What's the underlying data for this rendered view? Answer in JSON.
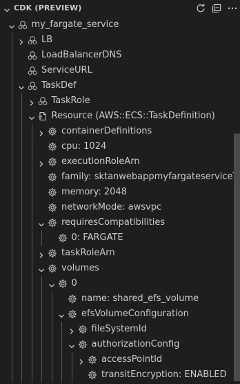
{
  "header": {
    "title": "CDK (PREVIEW)",
    "actions": [
      {
        "name": "refresh-icon"
      },
      {
        "name": "collapse-all-icon"
      }
    ]
  },
  "tree": [
    {
      "label": "my_fargate_service",
      "depth": 1,
      "twisty": "expanded",
      "icon": "construct-icon"
    },
    {
      "label": "LB",
      "depth": 2,
      "twisty": "collapsed",
      "icon": "construct-icon"
    },
    {
      "label": "LoadBalancerDNS",
      "depth": 2,
      "twisty": "none",
      "icon": "construct-icon"
    },
    {
      "label": "ServiceURL",
      "depth": 2,
      "twisty": "none",
      "icon": "construct-icon"
    },
    {
      "label": "TaskDef",
      "depth": 2,
      "twisty": "expanded",
      "icon": "construct-icon"
    },
    {
      "label": "TaskRole",
      "depth": 3,
      "twisty": "collapsed",
      "icon": "construct-icon"
    },
    {
      "label": "Resource (AWS::ECS::TaskDefinition)",
      "depth": 3,
      "twisty": "expanded",
      "icon": "resource-icon"
    },
    {
      "label": "containerDefinitions",
      "depth": 4,
      "twisty": "collapsed",
      "icon": "gear-icon"
    },
    {
      "label": "cpu: 1024",
      "depth": 4,
      "twisty": "none",
      "icon": "gear-icon"
    },
    {
      "label": "executionRoleArn",
      "depth": 4,
      "twisty": "collapsed",
      "icon": "gear-icon"
    },
    {
      "label": "family: sktanwebappmyfargateserviceT...",
      "depth": 4,
      "twisty": "none",
      "icon": "gear-icon"
    },
    {
      "label": "memory: 2048",
      "depth": 4,
      "twisty": "none",
      "icon": "gear-icon"
    },
    {
      "label": "networkMode: awsvpc",
      "depth": 4,
      "twisty": "none",
      "icon": "gear-icon"
    },
    {
      "label": "requiresCompatibilities",
      "depth": 4,
      "twisty": "expanded",
      "icon": "gear-icon"
    },
    {
      "label": "0: FARGATE",
      "depth": 5,
      "twisty": "none",
      "icon": "gear-icon"
    },
    {
      "label": "taskRoleArn",
      "depth": 4,
      "twisty": "collapsed",
      "icon": "gear-icon"
    },
    {
      "label": "volumes",
      "depth": 4,
      "twisty": "expanded",
      "icon": "gear-icon"
    },
    {
      "label": "0",
      "depth": 5,
      "twisty": "expanded",
      "icon": "gear-icon"
    },
    {
      "label": "name: shared_efs_volume",
      "depth": 6,
      "twisty": "none",
      "icon": "gear-icon"
    },
    {
      "label": "efsVolumeConfiguration",
      "depth": 6,
      "twisty": "expanded",
      "icon": "gear-icon"
    },
    {
      "label": "fileSystemId",
      "depth": 7,
      "twisty": "collapsed",
      "icon": "gear-icon"
    },
    {
      "label": "authorizationConfig",
      "depth": 7,
      "twisty": "expanded",
      "icon": "gear-icon"
    },
    {
      "label": "accessPointId",
      "depth": 8,
      "twisty": "collapsed",
      "icon": "gear-icon"
    },
    {
      "label": "transitEncryption: ENABLED",
      "depth": 8,
      "twisty": "none",
      "icon": "gear-icon"
    }
  ],
  "colors": {
    "background": "#1e1e1e",
    "text": "#cccccc",
    "icon": "#c5c5c5",
    "indent_guide": "#585858",
    "scrollbar": "#4b4b4b"
  }
}
